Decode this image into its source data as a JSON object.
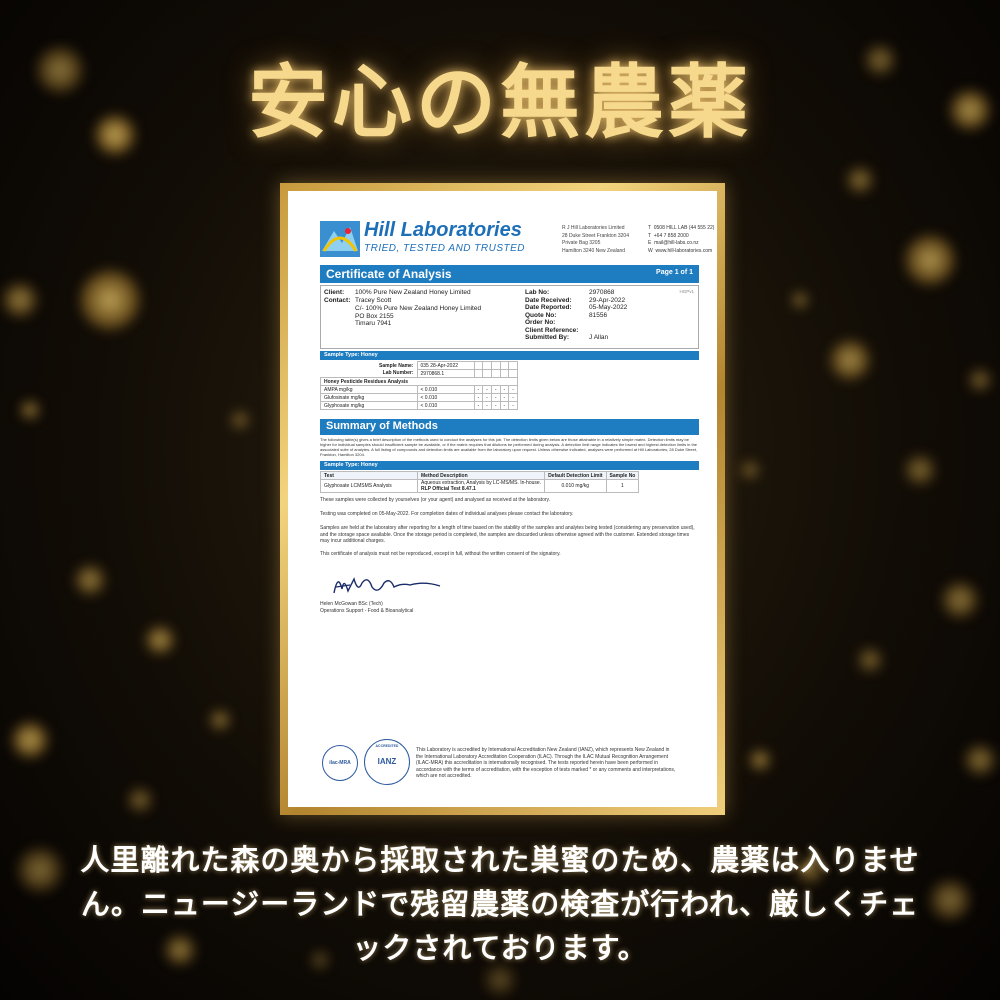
{
  "title": "安心の無農薬",
  "caption": "人里離れた森の奥から採取された巣蜜のため、農薬は入りません。ニュージーランドで残留農薬の検査が行われ、厳しくチェックされております。",
  "certificate": {
    "lab_name": "Hill Laboratories",
    "lab_tagline": "TRIED, TESTED AND TRUSTED",
    "address": "R J Hill Laboratories Limited\n28 Duke Street Frankton 3204\nPrivate Bag 3205\nHamilton 3240 New Zealand",
    "contact": "T  0508 HILL LAB (44 555 22)\nT  +64 7 858 2000\nE  mail@hill-labs.co.nz\nW  www.hill-laboratories.com",
    "doc_title": "Certificate of Analysis",
    "page": "Page 1 of 1",
    "client_label": "Client:",
    "client": "100% Pure New Zealand Honey Limited",
    "contact_label": "Contact:",
    "contact_name": "Tracey Scott",
    "contact_addr": "C/- 100% Pure New Zealand Honey Limited\nPO Box 2155\nTimaru 7941",
    "fields": [
      {
        "k": "Lab No:",
        "v": "2970868"
      },
      {
        "k": "Date Received:",
        "v": "29-Apr-2022"
      },
      {
        "k": "Date Reported:",
        "v": "05-May-2022"
      },
      {
        "k": "Quote No:",
        "v": "81556"
      },
      {
        "k": "Order No:",
        "v": ""
      },
      {
        "k": "Client Reference:",
        "v": ""
      },
      {
        "k": "Submitted By:",
        "v": "J Allan"
      }
    ],
    "hgpv": "HGPv1",
    "sample_type": "Sample Type: Honey",
    "sample_name_label": "Sample Name:",
    "sample_name": "035 28-Apr-2022",
    "lab_number_label": "Lab Number:",
    "lab_number": "2970868.1",
    "residues_heading": "Honey Pesticide Residues Analysis",
    "residues": [
      {
        "name": "AMPA",
        "unit": "mg/kg",
        "value": "< 0.010"
      },
      {
        "name": "Glufosinate",
        "unit": "mg/kg",
        "value": "< 0.010"
      },
      {
        "name": "Glyphosate",
        "unit": "mg/kg",
        "value": "< 0.010"
      }
    ],
    "dash": "-",
    "summary_title": "Summary of Methods",
    "summary_text": "The following table(s) gives a brief description of the methods used to conduct the analyses for this job. The detection limits given below are those attainable in a relatively simple matrix. Detection limits may be higher for individual samples should insufficient sample be available, or if the matrix requires that dilutions be performed during analysis. A detection limit range indicates the lowest and highest detection limits in the associated suite of analytes. A full listing of compounds and detection limits are available from the laboratory upon request. Unless otherwise indicated, analyses were performed at Hill Laboratories, 28 Duke Street, Frankton, Hamilton 3204.",
    "methods_header": [
      "Test",
      "Method Description",
      "Default Detection Limit",
      "Sample No"
    ],
    "method_row": [
      "Glyphosate LCMSMS Analysis",
      "Aqueous extraction, Analysis by LC-MS/MS. In-house.",
      "0.010 mg/kg",
      "1"
    ],
    "method_rlp": "RLP Official Test 8.47.1",
    "para1": "These samples were collected by yourselves (or your agent) and analysed as received at the laboratory.",
    "para2": "Testing was completed on 05-May-2022. For completion dates of individual analyses please contact the laboratory.",
    "para3": "Samples are held at the laboratory after reporting for a length of time based on the stability of the samples and analytes being tested (considering any preservation used), and the storage space available. Once the storage period is completed, the samples are discarded unless otherwise agreed with the customer. Extended storage times may incur additional charges.",
    "para4": "This certificate of analysis must not be reproduced, except in full, without the written consent of the signatory.",
    "signatory": "Helen McGowan BSc (Tech)",
    "signatory_role": "Operations Support - Food & Bioanalytical",
    "ilac": "ilac-MRA",
    "ianz_top": "ACCREDITED",
    "ianz": "IANZ",
    "accreditation": "This Laboratory is accredited by International Accreditation New Zealand (IANZ), which represents New Zealand in the International Laboratory Accreditation Cooperation (ILAC). Through the ILAC Mutual Recognition Arrangement (ILAC-MRA) this accreditation is internationally recognised. The tests reported herein have been performed in accordance with the terms of accreditation, with the exception of tests marked * or any comments and interpretations, which are not accredited."
  },
  "colors": {
    "gold": "#f6d98d",
    "lab_blue": "#1e7cc0"
  }
}
